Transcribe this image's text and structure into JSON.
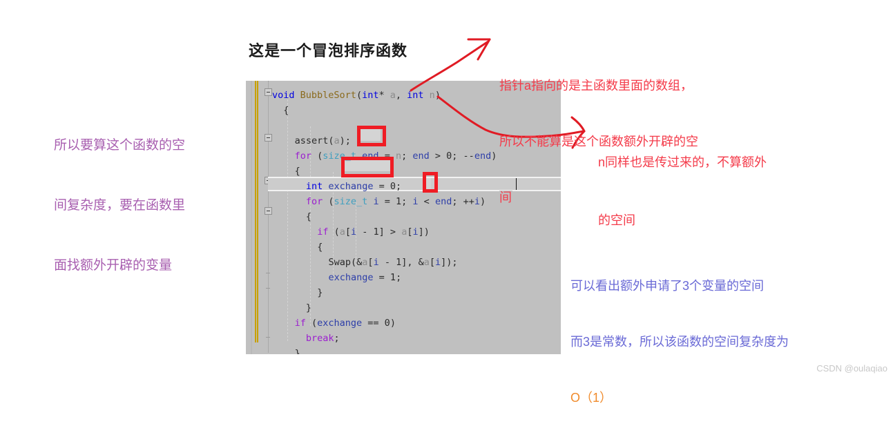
{
  "title": "这是一个冒泡排序函数",
  "watermark": "CSDN @oulaqiao",
  "colors": {
    "code_background": "#c0c0c0",
    "annotation_red": "#f43b4a",
    "annotation_purple": "#a85fb0",
    "annotation_blue": "#6a6ad6",
    "annotation_orange": "#f08a2a",
    "highlight_box_red": "#ef1c24",
    "change_bar_yellow": "#c8a000"
  },
  "code": {
    "language": "C",
    "lines": [
      {
        "indent": 0,
        "tokens": [
          {
            "t": "void",
            "c": "kw"
          },
          {
            "t": " ",
            "c": "pl"
          },
          {
            "t": "BubbleSort",
            "c": "fn"
          },
          {
            "t": "(",
            "c": "pl"
          },
          {
            "t": "int",
            "c": "kw"
          },
          {
            "t": "* ",
            "c": "pl"
          },
          {
            "t": "a",
            "c": "dim"
          },
          {
            "t": ", ",
            "c": "pl"
          },
          {
            "t": "int",
            "c": "kw"
          },
          {
            "t": " ",
            "c": "pl"
          },
          {
            "t": "n",
            "c": "dim"
          },
          {
            "t": ")",
            "c": "pl"
          }
        ]
      },
      {
        "indent": 1,
        "tokens": [
          {
            "t": "{",
            "c": "pl"
          }
        ]
      },
      {
        "indent": 0,
        "tokens": []
      },
      {
        "indent": 2,
        "tokens": [
          {
            "t": "assert",
            "c": "pl"
          },
          {
            "t": "(",
            "c": "pl"
          },
          {
            "t": "a",
            "c": "dim"
          },
          {
            "t": ");",
            "c": "pl"
          }
        ]
      },
      {
        "indent": 2,
        "tokens": [
          {
            "t": "for",
            "c": "ctl"
          },
          {
            "t": " (",
            "c": "pl"
          },
          {
            "t": "size_t",
            "c": "typ"
          },
          {
            "t": " ",
            "c": "pl"
          },
          {
            "t": "end",
            "c": "id"
          },
          {
            "t": " = ",
            "c": "pl"
          },
          {
            "t": "n",
            "c": "dim"
          },
          {
            "t": "; ",
            "c": "pl"
          },
          {
            "t": "end",
            "c": "id"
          },
          {
            "t": " > ",
            "c": "pl"
          },
          {
            "t": "0",
            "c": "num"
          },
          {
            "t": "; ",
            "c": "pl"
          },
          {
            "t": "--",
            "c": "pl"
          },
          {
            "t": "end",
            "c": "id"
          },
          {
            "t": ")",
            "c": "pl"
          }
        ]
      },
      {
        "indent": 2,
        "tokens": [
          {
            "t": "{",
            "c": "pl"
          }
        ]
      },
      {
        "indent": 3,
        "tokens": [
          {
            "t": "int",
            "c": "kw"
          },
          {
            "t": " ",
            "c": "pl"
          },
          {
            "t": "exchange",
            "c": "id"
          },
          {
            "t": " = ",
            "c": "pl"
          },
          {
            "t": "0",
            "c": "num"
          },
          {
            "t": ";",
            "c": "pl"
          }
        ]
      },
      {
        "indent": 3,
        "tokens": [
          {
            "t": "for",
            "c": "ctl"
          },
          {
            "t": " (",
            "c": "pl"
          },
          {
            "t": "size_t",
            "c": "typ"
          },
          {
            "t": " ",
            "c": "pl"
          },
          {
            "t": "i",
            "c": "id"
          },
          {
            "t": " = ",
            "c": "pl"
          },
          {
            "t": "1",
            "c": "num"
          },
          {
            "t": "; ",
            "c": "pl"
          },
          {
            "t": "i",
            "c": "id"
          },
          {
            "t": " < ",
            "c": "pl"
          },
          {
            "t": "end",
            "c": "id"
          },
          {
            "t": "; ++",
            "c": "pl"
          },
          {
            "t": "i",
            "c": "id"
          },
          {
            "t": ")",
            "c": "pl"
          }
        ]
      },
      {
        "indent": 3,
        "tokens": [
          {
            "t": "{",
            "c": "pl"
          }
        ]
      },
      {
        "indent": 4,
        "tokens": [
          {
            "t": "if",
            "c": "ctl"
          },
          {
            "t": " (",
            "c": "pl"
          },
          {
            "t": "a",
            "c": "dim"
          },
          {
            "t": "[",
            "c": "pl"
          },
          {
            "t": "i",
            "c": "id"
          },
          {
            "t": " - ",
            "c": "pl"
          },
          {
            "t": "1",
            "c": "num"
          },
          {
            "t": "] > ",
            "c": "pl"
          },
          {
            "t": "a",
            "c": "dim"
          },
          {
            "t": "[",
            "c": "pl"
          },
          {
            "t": "i",
            "c": "id"
          },
          {
            "t": "])",
            "c": "pl"
          }
        ]
      },
      {
        "indent": 4,
        "tokens": [
          {
            "t": "{",
            "c": "pl"
          }
        ]
      },
      {
        "indent": 5,
        "tokens": [
          {
            "t": "Swap",
            "c": "pl"
          },
          {
            "t": "(&",
            "c": "pl"
          },
          {
            "t": "a",
            "c": "dim"
          },
          {
            "t": "[",
            "c": "pl"
          },
          {
            "t": "i",
            "c": "id"
          },
          {
            "t": " - ",
            "c": "pl"
          },
          {
            "t": "1",
            "c": "num"
          },
          {
            "t": "], &",
            "c": "pl"
          },
          {
            "t": "a",
            "c": "dim"
          },
          {
            "t": "[",
            "c": "pl"
          },
          {
            "t": "i",
            "c": "id"
          },
          {
            "t": "]);",
            "c": "pl"
          }
        ]
      },
      {
        "indent": 5,
        "tokens": [
          {
            "t": "exchange",
            "c": "id"
          },
          {
            "t": " = ",
            "c": "pl"
          },
          {
            "t": "1",
            "c": "num"
          },
          {
            "t": ";",
            "c": "pl"
          }
        ]
      },
      {
        "indent": 4,
        "tokens": [
          {
            "t": "}",
            "c": "pl"
          }
        ]
      },
      {
        "indent": 3,
        "tokens": [
          {
            "t": "}",
            "c": "pl"
          }
        ]
      },
      {
        "indent": 2,
        "tokens": [
          {
            "t": "if",
            "c": "ctl"
          },
          {
            "t": " (",
            "c": "pl"
          },
          {
            "t": "exchange",
            "c": "id"
          },
          {
            "t": " == ",
            "c": "pl"
          },
          {
            "t": "0",
            "c": "num"
          },
          {
            "t": ")",
            "c": "pl"
          }
        ]
      },
      {
        "indent": 3,
        "tokens": [
          {
            "t": "break",
            "c": "ctl"
          },
          {
            "t": ";",
            "c": "pl"
          }
        ]
      },
      {
        "indent": 2,
        "tokens": [
          {
            "t": "}",
            "c": "pl"
          }
        ]
      },
      {
        "indent": 1,
        "tokens": [
          {
            "t": "}",
            "c": "pl"
          }
        ]
      }
    ],
    "plain_text": "void BubbleSort(int* a, int n)\n{\n\n    assert(a);\n    for (size_t end = n; end > 0; --end)\n    {\n        int exchange = 0;\n        for (size_t i = 1; i < end; ++i)\n        {\n            if (a[i - 1] > a[i])\n            {\n                Swap(&a[i - 1], &a[i]);\n                exchange = 1;\n            }\n        }\n        if (exchange == 0)\n            break;\n    }\n}",
    "highlighted_variables": [
      "end",
      "exchange",
      "i"
    ],
    "current_line": "for (size_t i = 1; i < end; ++i)"
  },
  "annotations": {
    "left": {
      "lines": [
        "所以要算这个函数的空",
        "间复杂度，要在函数里",
        "面找额外开辟的变量"
      ],
      "color": "#a85fb0"
    },
    "top_right": {
      "lines": [
        "指针a指向的是主函数里面的数组，",
        "所以不能算是这个函数额外开辟的空",
        "间"
      ],
      "color": "#f43b4a"
    },
    "n_note": {
      "lines": [
        "n同样也是传过来的，不算额外",
        "的空间"
      ],
      "color": "#f43b4a"
    },
    "bottom": {
      "lines": [
        "可以看出额外申请了3个变量的空间",
        "而3是常数，所以该函数的空间复杂度为"
      ],
      "result": "O（1）",
      "color": "#6a6ad6",
      "result_color": "#f08a2a"
    }
  }
}
